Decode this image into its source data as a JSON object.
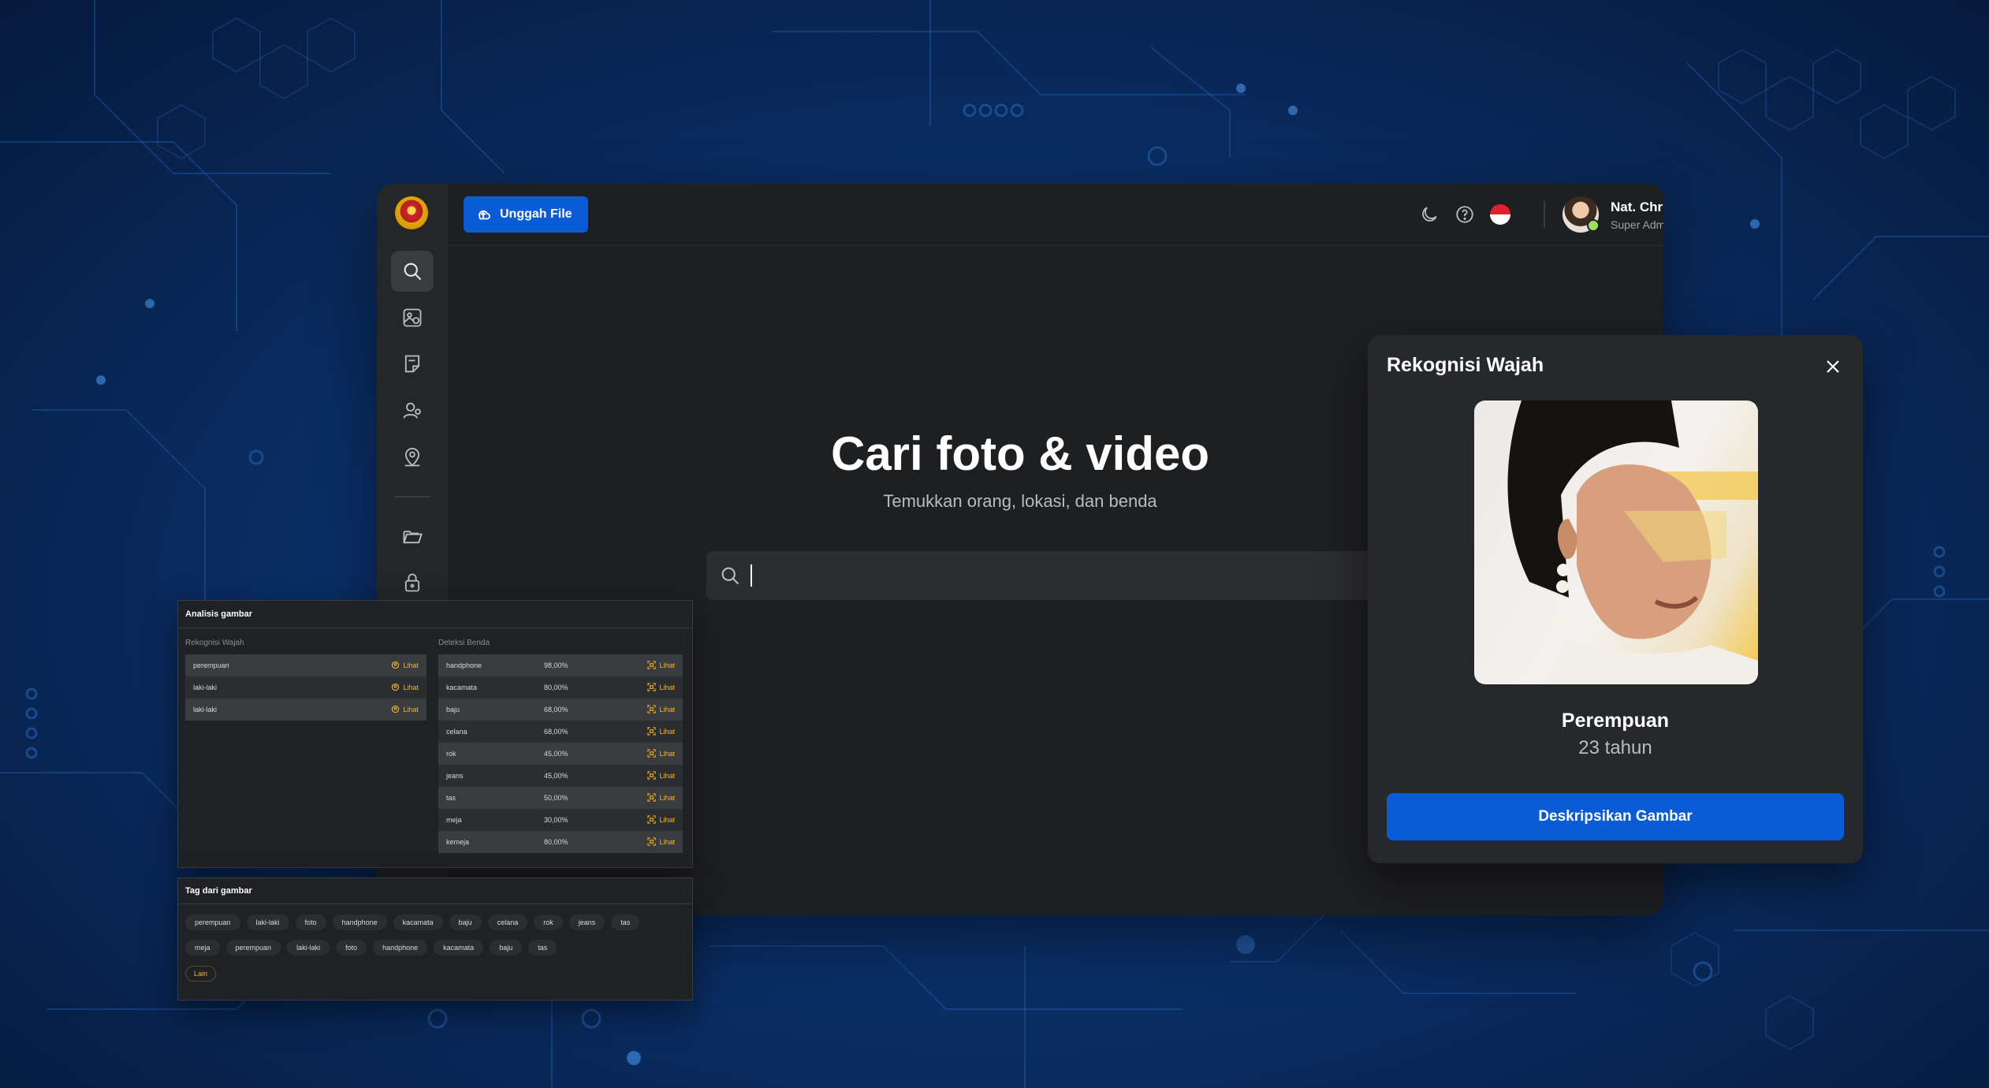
{
  "colors": {
    "accent": "#0a5bd8",
    "warning": "#f0b429",
    "background": "#0a2f66"
  },
  "topbar": {
    "upload_label": "Unggah File",
    "user_name": "Nat. Christabella",
    "user_role": "Super Admin"
  },
  "sidebar": {
    "items": [
      {
        "icon": "search-icon",
        "active": true
      },
      {
        "icon": "image-search-icon",
        "active": false
      },
      {
        "icon": "tag-icon",
        "active": false
      },
      {
        "icon": "face-recognition-icon",
        "active": false
      },
      {
        "icon": "location-icon",
        "active": false
      },
      {
        "icon": "folder-icon",
        "active": false
      },
      {
        "icon": "lock-icon",
        "active": false
      }
    ]
  },
  "main": {
    "title": "Cari foto & video",
    "subtitle": "Temukkan orang, lokasi, dan benda",
    "search_value": ""
  },
  "modal": {
    "title": "Rekognisi Wajah",
    "gender": "Perempuan",
    "age": "23 tahun",
    "button": "Deskripsikan Gambar"
  },
  "analysis": {
    "title": "Analisis gambar",
    "face_label": "Rekognisi Wajah",
    "object_label": "Deteksi Benda",
    "see_label": "Lihat",
    "faces": [
      "perempuan",
      "laki-laki",
      "laki-laki"
    ],
    "objects": [
      {
        "name": "handphone",
        "pct": "98,00%"
      },
      {
        "name": "kacamata",
        "pct": "80,00%"
      },
      {
        "name": "baju",
        "pct": "68,00%"
      },
      {
        "name": "celana",
        "pct": "68,00%"
      },
      {
        "name": "rok",
        "pct": "45,00%"
      },
      {
        "name": "jeans",
        "pct": "45,00%"
      },
      {
        "name": "tas",
        "pct": "50,00%"
      },
      {
        "name": "meja",
        "pct": "30,00%"
      },
      {
        "name": "kemeja",
        "pct": "80,00%"
      }
    ]
  },
  "tags": {
    "title": "Tag dari gambar",
    "row1": [
      "perempuan",
      "laki-laki",
      "foto",
      "handphone",
      "kacamata",
      "baju",
      "celana",
      "rok",
      "jeans",
      "tas"
    ],
    "row2": [
      "meja",
      "perempuan",
      "laki-laki",
      "foto",
      "handphone",
      "kacamata",
      "baju",
      "tas"
    ],
    "more": "Lain"
  }
}
